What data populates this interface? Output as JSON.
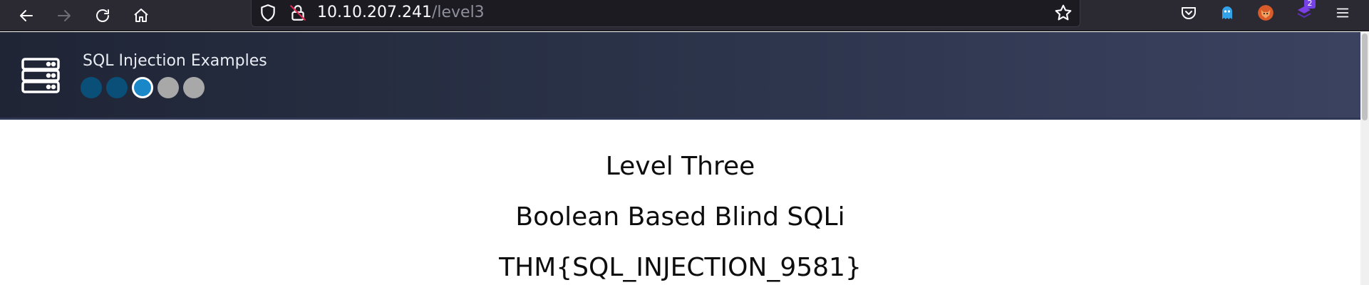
{
  "browser": {
    "url_host": "10.10.207.241",
    "url_path": "/level3",
    "extension_badge": "2"
  },
  "header": {
    "title": "SQL Injection Examples",
    "progress": {
      "total_levels": 5,
      "current_level": 3,
      "completed_levels": 2
    }
  },
  "main": {
    "heading": "Level Three",
    "subheading": "Boolean Based Blind SQLi",
    "flag": "THM{SQL_INJECTION_9581}"
  },
  "colors": {
    "toolbar": "#2b2a33",
    "header_gradient_start": "#1f2535",
    "header_gradient_end": "#3a4260",
    "dot_completed": "#0a4f78",
    "dot_current": "#1a87c9",
    "dot_pending": "#a8a8a8"
  }
}
